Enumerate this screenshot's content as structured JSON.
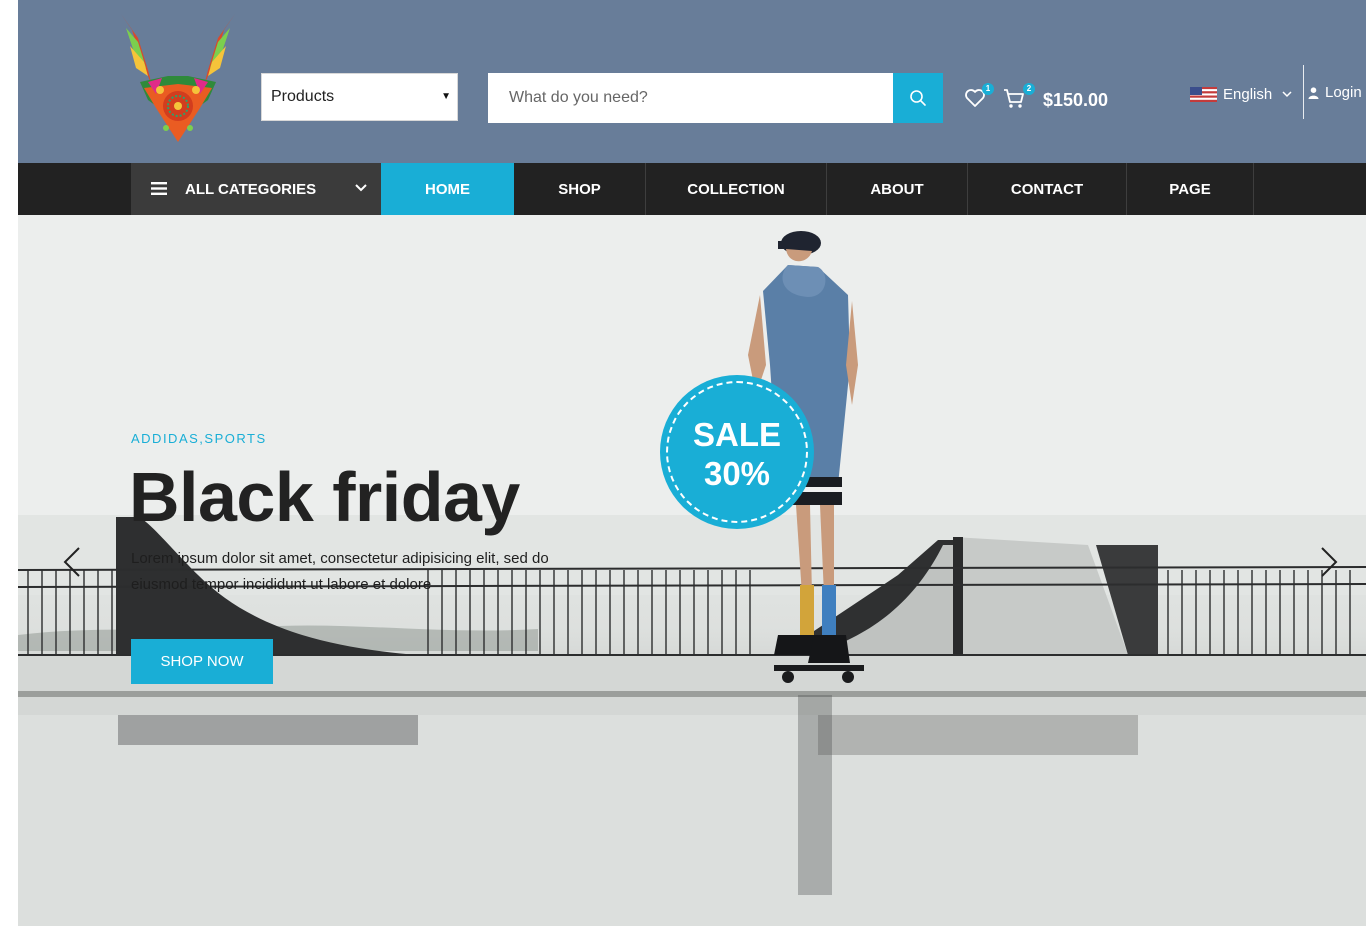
{
  "header": {
    "logo_icon": "colorful-deer-head-logo",
    "category_select": {
      "selected": "Products"
    },
    "search": {
      "placeholder": "What do you need?",
      "button_icon": "search-icon"
    },
    "wishlist": {
      "icon": "heart-icon",
      "count": "1"
    },
    "cart": {
      "icon": "cart-icon",
      "count": "2",
      "total": "$150.00"
    },
    "language": {
      "label": "English",
      "flag_icon": "us-flag-icon"
    },
    "login": {
      "label": "Login",
      "icon": "user-icon"
    }
  },
  "nav": {
    "categories_label": "ALL CATEGORIES",
    "items": [
      {
        "label": "HOME",
        "active": true
      },
      {
        "label": "SHOP"
      },
      {
        "label": "COLLECTION"
      },
      {
        "label": "ABOUT"
      },
      {
        "label": "CONTACT"
      },
      {
        "label": "PAGE"
      }
    ]
  },
  "hero": {
    "brand": "ADDIDAS,SPORTS",
    "title": "Black friday",
    "description": "Lorem ipsum dolor sit amet, consectetur adipisicing elit, sed do eiusmod tempor incididunt ut labore et dolore",
    "button": "SHOP NOW",
    "sale": {
      "line1": "SALE",
      "line2": "30%"
    }
  },
  "colors": {
    "header_bg": "#687d99",
    "nav_bg": "#222222",
    "accent": "#19aed6"
  }
}
